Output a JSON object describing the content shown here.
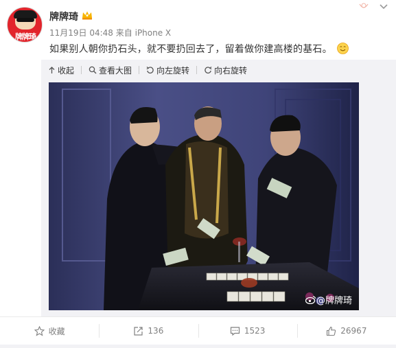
{
  "post": {
    "user_name": "牌牌琦",
    "avatar_text": "牌牌琦",
    "time": "11月19日 04:48",
    "from_label": "来自",
    "device": "iPhone X",
    "content": "如果别人朝你扔石头，就不要扔回去了，留着做你建高楼的基石。",
    "watermark": "@牌牌琦"
  },
  "toolbar": {
    "collapse": "收起",
    "view_large": "查看大图",
    "rotate_left": "向左旋转",
    "rotate_right": "向右旋转"
  },
  "footer": {
    "favorite": "收藏",
    "repost_count": "136",
    "comment_count": "1523",
    "like_count": "26967"
  },
  "colors": {
    "brand_red": "#e2242b",
    "link_blue": "#eb7350",
    "text": "#333333",
    "muted": "#808080"
  },
  "icons": [
    "crown-icon",
    "smile-icon",
    "collapse-icon",
    "zoom-icon",
    "rotate-left-icon",
    "rotate-right-icon",
    "star-icon",
    "repost-icon",
    "comment-icon",
    "like-icon",
    "weibo-icon"
  ]
}
